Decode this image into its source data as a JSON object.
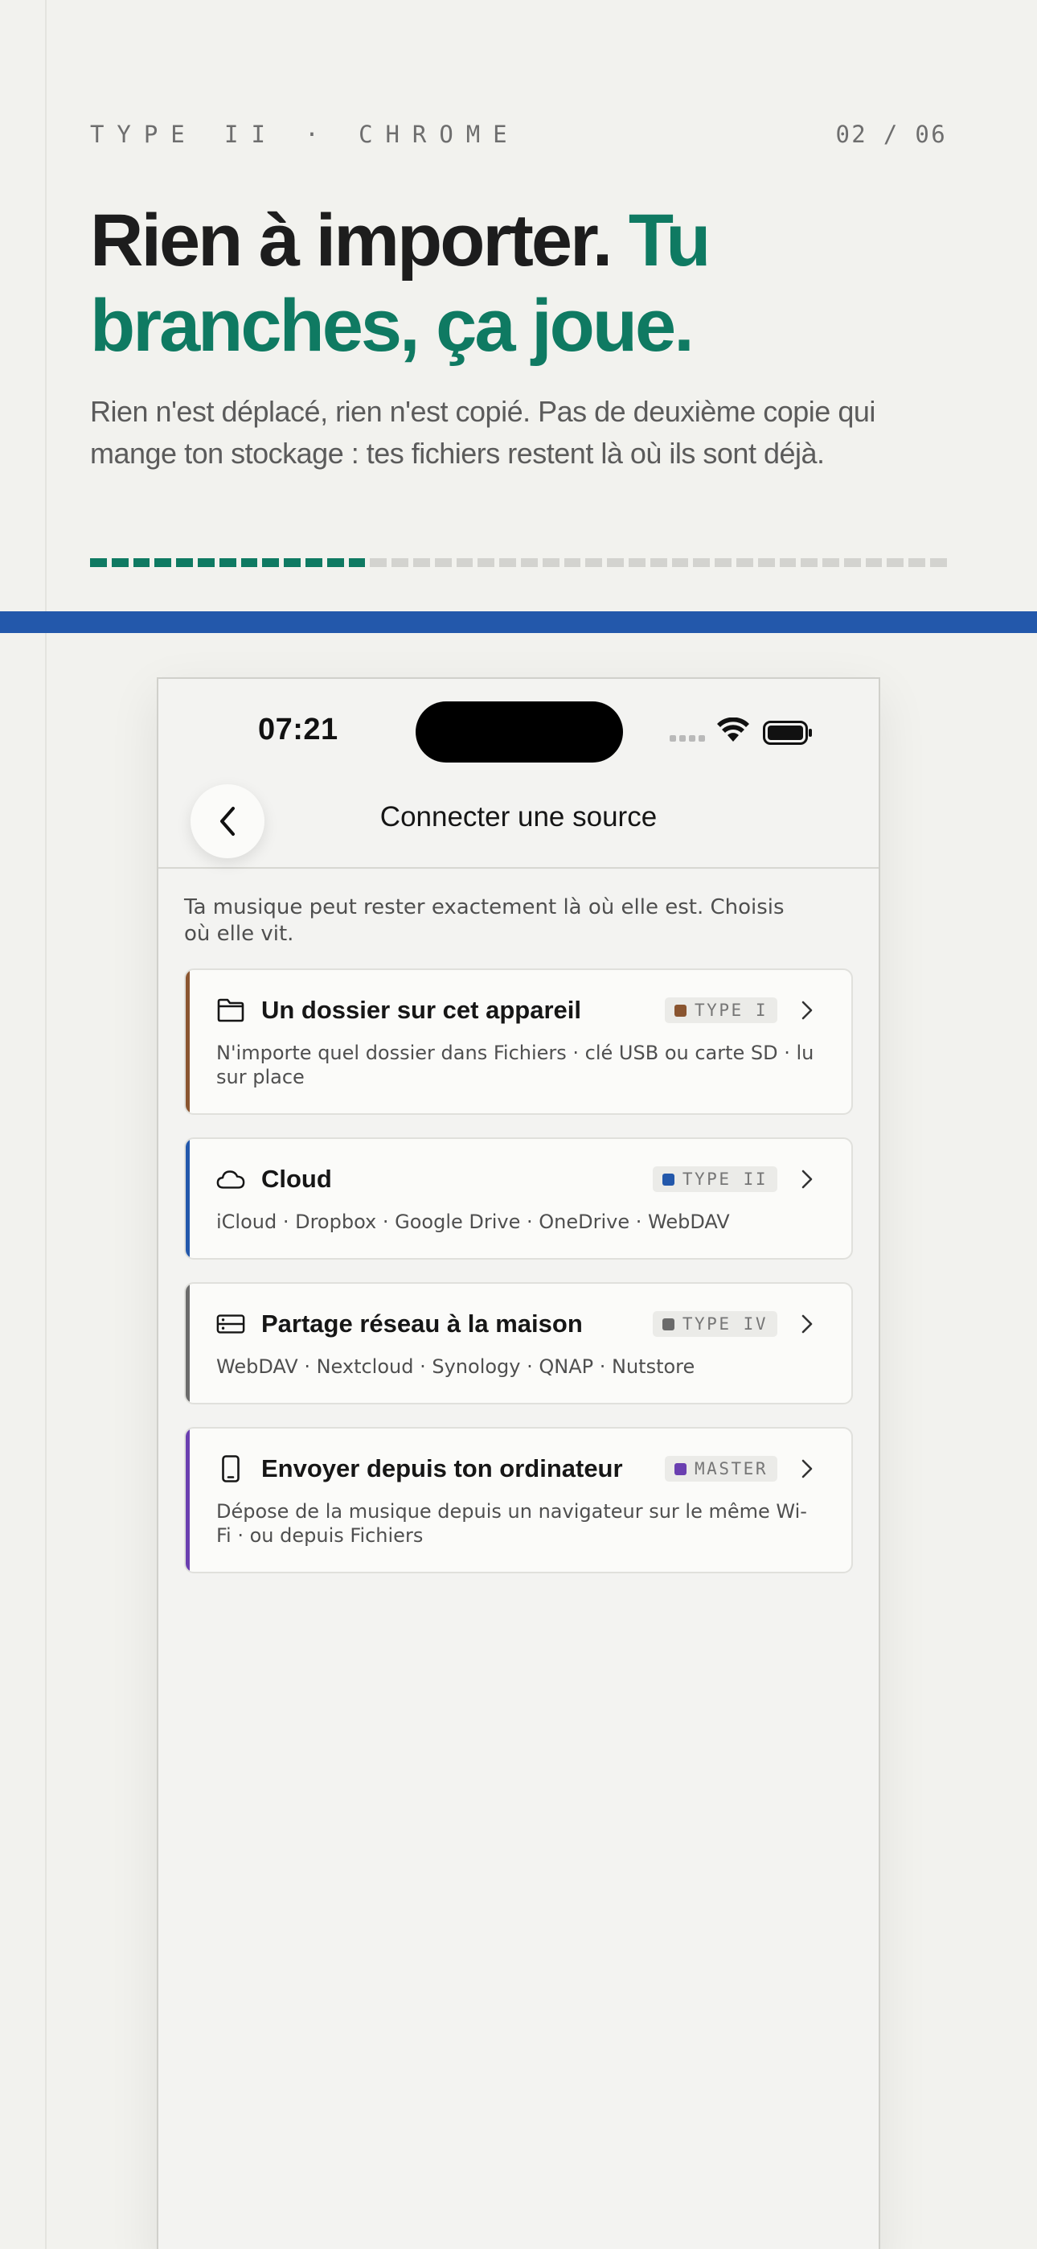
{
  "header": {
    "eyebrow": "TYPE II · CHROME",
    "counter": "02 / 06",
    "headline_plain": "Rien à importer.",
    "headline_accent": "Tu branches, ça joue.",
    "subtitle": "Rien n'est déplacé, rien n'est copié. Pas de deuxième copie qui mange ton stockage : tes fichiers restent là où ils sont déjà.",
    "progress": {
      "filled": 13,
      "total": 40
    }
  },
  "colors": {
    "accent_green": "#0f7a62",
    "band_blue": "#2358ab",
    "type_i": "#8a5530",
    "type_ii": "#2358ab",
    "type_iv": "#6b6b6b",
    "master": "#6a3fb0"
  },
  "phone": {
    "status": {
      "time": "07:21"
    },
    "nav": {
      "title": "Connecter une source",
      "back_icon": "chevron-left-icon"
    },
    "intro": "Ta musique peut rester exactement là où elle est. Choisis où elle vit.",
    "sources": [
      {
        "icon": "folder-icon",
        "title": "Un dossier sur cet appareil",
        "badge": "TYPE I",
        "badge_color": "#8a5530",
        "description": "N'importe quel dossier dans Fichiers · clé USB ou carte SD · lu sur place"
      },
      {
        "icon": "cloud-icon",
        "title": "Cloud",
        "badge": "TYPE II",
        "badge_color": "#2358ab",
        "description": "iCloud · Dropbox · Google Drive · OneDrive · WebDAV"
      },
      {
        "icon": "server-icon",
        "title": "Partage réseau à la maison",
        "badge": "TYPE IV",
        "badge_color": "#6b6b6b",
        "description": "WebDAV · Nextcloud · Synology · QNAP · Nutstore"
      },
      {
        "icon": "phone-icon",
        "title": "Envoyer depuis ton ordinateur",
        "badge": "MASTER",
        "badge_color": "#6a3fb0",
        "description": "Dépose de la musique depuis un navigateur sur le même Wi-Fi · ou depuis Fichiers"
      }
    ]
  }
}
